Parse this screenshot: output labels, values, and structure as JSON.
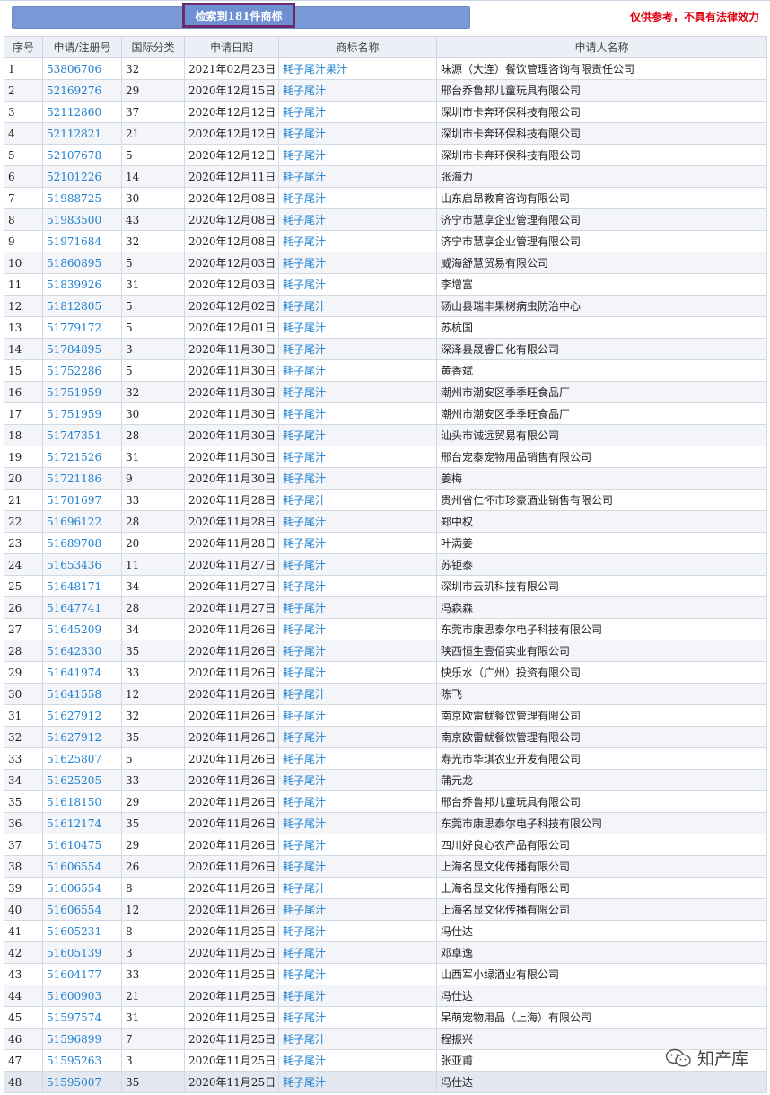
{
  "header": {
    "search_result_label": "检索到181件商标",
    "disclaimer": "仅供参考，不具有法律效力"
  },
  "table": {
    "columns": [
      "序号",
      "申请/注册号",
      "国际分类",
      "申请日期",
      "商标名称",
      "申请人名称"
    ],
    "rows": [
      [
        "1",
        "53806706",
        "32",
        "2021年02月23日",
        "耗子尾汁果汁",
        "味源（大连）餐饮管理咨询有限责任公司"
      ],
      [
        "2",
        "52169276",
        "29",
        "2020年12月15日",
        "耗子尾汁",
        "邢台乔鲁邦儿童玩具有限公司"
      ],
      [
        "3",
        "52112860",
        "37",
        "2020年12月12日",
        "耗子尾汁",
        "深圳市卡奔环保科技有限公司"
      ],
      [
        "4",
        "52112821",
        "21",
        "2020年12月12日",
        "耗子尾汁",
        "深圳市卡奔环保科技有限公司"
      ],
      [
        "5",
        "52107678",
        "5",
        "2020年12月12日",
        "耗子尾汁",
        "深圳市卡奔环保科技有限公司"
      ],
      [
        "6",
        "52101226",
        "14",
        "2020年12月11日",
        "耗子尾汁",
        "张海力"
      ],
      [
        "7",
        "51988725",
        "30",
        "2020年12月08日",
        "耗子尾汁",
        "山东启昂教育咨询有限公司"
      ],
      [
        "8",
        "51983500",
        "43",
        "2020年12月08日",
        "耗子尾汁",
        "济宁市慧享企业管理有限公司"
      ],
      [
        "9",
        "51971684",
        "32",
        "2020年12月08日",
        "耗子尾汁",
        "济宁市慧享企业管理有限公司"
      ],
      [
        "10",
        "51860895",
        "5",
        "2020年12月03日",
        "耗子尾汁",
        "威海舒慧贸易有限公司"
      ],
      [
        "11",
        "51839926",
        "31",
        "2020年12月03日",
        "耗子尾汁",
        "李增富"
      ],
      [
        "12",
        "51812805",
        "5",
        "2020年12月02日",
        "耗子尾汁",
        "砀山县瑞丰果树病虫防治中心"
      ],
      [
        "13",
        "51779172",
        "5",
        "2020年12月01日",
        "耗子尾汁",
        "苏杭国"
      ],
      [
        "14",
        "51784895",
        "3",
        "2020年11月30日",
        "耗子尾汁",
        "深泽县晟睿日化有限公司"
      ],
      [
        "15",
        "51752286",
        "5",
        "2020年11月30日",
        "耗子尾汁",
        "黄香斌"
      ],
      [
        "16",
        "51751959",
        "32",
        "2020年11月30日",
        "耗子尾汁",
        "潮州市潮安区季季旺食品厂"
      ],
      [
        "17",
        "51751959",
        "30",
        "2020年11月30日",
        "耗子尾汁",
        "潮州市潮安区季季旺食品厂"
      ],
      [
        "18",
        "51747351",
        "28",
        "2020年11月30日",
        "耗子尾汁",
        "汕头市诚远贸易有限公司"
      ],
      [
        "19",
        "51721526",
        "31",
        "2020年11月30日",
        "耗子尾汁",
        "邢台宠泰宠物用品销售有限公司"
      ],
      [
        "20",
        "51721186",
        "9",
        "2020年11月30日",
        "耗子尾汁",
        "姜梅"
      ],
      [
        "21",
        "51701697",
        "33",
        "2020年11月28日",
        "耗子尾汁",
        "贵州省仁怀市珍豪酒业销售有限公司"
      ],
      [
        "22",
        "51696122",
        "28",
        "2020年11月28日",
        "耗子尾汁",
        "郑中权"
      ],
      [
        "23",
        "51689708",
        "20",
        "2020年11月28日",
        "耗子尾汁",
        "叶满姜"
      ],
      [
        "24",
        "51653436",
        "11",
        "2020年11月27日",
        "耗子尾汁",
        "苏钜泰"
      ],
      [
        "25",
        "51648171",
        "34",
        "2020年11月27日",
        "耗子尾汁",
        "深圳市云玑科技有限公司"
      ],
      [
        "26",
        "51647741",
        "28",
        "2020年11月27日",
        "耗子尾汁",
        "冯森森"
      ],
      [
        "27",
        "51645209",
        "34",
        "2020年11月26日",
        "耗子尾汁",
        "东莞市康思泰尔电子科技有限公司"
      ],
      [
        "28",
        "51642330",
        "35",
        "2020年11月26日",
        "耗子尾汁",
        "陕西恒生壹佰实业有限公司"
      ],
      [
        "29",
        "51641974",
        "33",
        "2020年11月26日",
        "耗子尾汁",
        "快乐水（广州）投资有限公司"
      ],
      [
        "30",
        "51641558",
        "12",
        "2020年11月26日",
        "耗子尾汁",
        "陈飞"
      ],
      [
        "31",
        "51627912",
        "32",
        "2020年11月26日",
        "耗子尾汁",
        "南京欧雷鱿餐饮管理有限公司"
      ],
      [
        "32",
        "51627912",
        "35",
        "2020年11月26日",
        "耗子尾汁",
        "南京欧雷鱿餐饮管理有限公司"
      ],
      [
        "33",
        "51625807",
        "5",
        "2020年11月26日",
        "耗子尾汁",
        "寿光市华琪农业开发有限公司"
      ],
      [
        "34",
        "51625205",
        "33",
        "2020年11月26日",
        "耗子尾汁",
        "蒲元龙"
      ],
      [
        "35",
        "51618150",
        "29",
        "2020年11月26日",
        "耗子尾汁",
        "邢台乔鲁邦儿童玩具有限公司"
      ],
      [
        "36",
        "51612174",
        "35",
        "2020年11月26日",
        "耗子尾汁",
        "东莞市康思泰尔电子科技有限公司"
      ],
      [
        "37",
        "51610475",
        "29",
        "2020年11月26日",
        "耗子尾汁",
        "四川好良心农产品有限公司"
      ],
      [
        "38",
        "51606554",
        "26",
        "2020年11月26日",
        "耗子尾汁",
        "上海名显文化传播有限公司"
      ],
      [
        "39",
        "51606554",
        "8",
        "2020年11月26日",
        "耗子尾汁",
        "上海名显文化传播有限公司"
      ],
      [
        "40",
        "51606554",
        "12",
        "2020年11月26日",
        "耗子尾汁",
        "上海名显文化传播有限公司"
      ],
      [
        "41",
        "51605231",
        "8",
        "2020年11月25日",
        "耗子尾汁",
        "冯仕达"
      ],
      [
        "42",
        "51605139",
        "3",
        "2020年11月25日",
        "耗子尾汁",
        "邓卓逸"
      ],
      [
        "43",
        "51604177",
        "33",
        "2020年11月25日",
        "耗子尾汁",
        "山西军小绿酒业有限公司"
      ],
      [
        "44",
        "51600903",
        "21",
        "2020年11月25日",
        "耗子尾汁",
        "冯仕达"
      ],
      [
        "45",
        "51597574",
        "31",
        "2020年11月25日",
        "耗子尾汁",
        "呆萌宠物用品（上海）有限公司"
      ],
      [
        "46",
        "51596899",
        "7",
        "2020年11月25日",
        "耗子尾汁",
        "程振兴"
      ],
      [
        "47",
        "51595263",
        "3",
        "2020年11月25日",
        "耗子尾汁",
        "张亚甫"
      ],
      [
        "48",
        "51595007",
        "35",
        "2020年11月25日",
        "耗子尾汁",
        "冯仕达"
      ]
    ]
  },
  "watermark": {
    "icon": "wechat-icon",
    "text": "知产库"
  },
  "colors": {
    "link": "#1d7fd1",
    "disclaimer": "#e0000f",
    "search_bar": "#7b98d6",
    "highlight_border": "#6b2a6a"
  }
}
